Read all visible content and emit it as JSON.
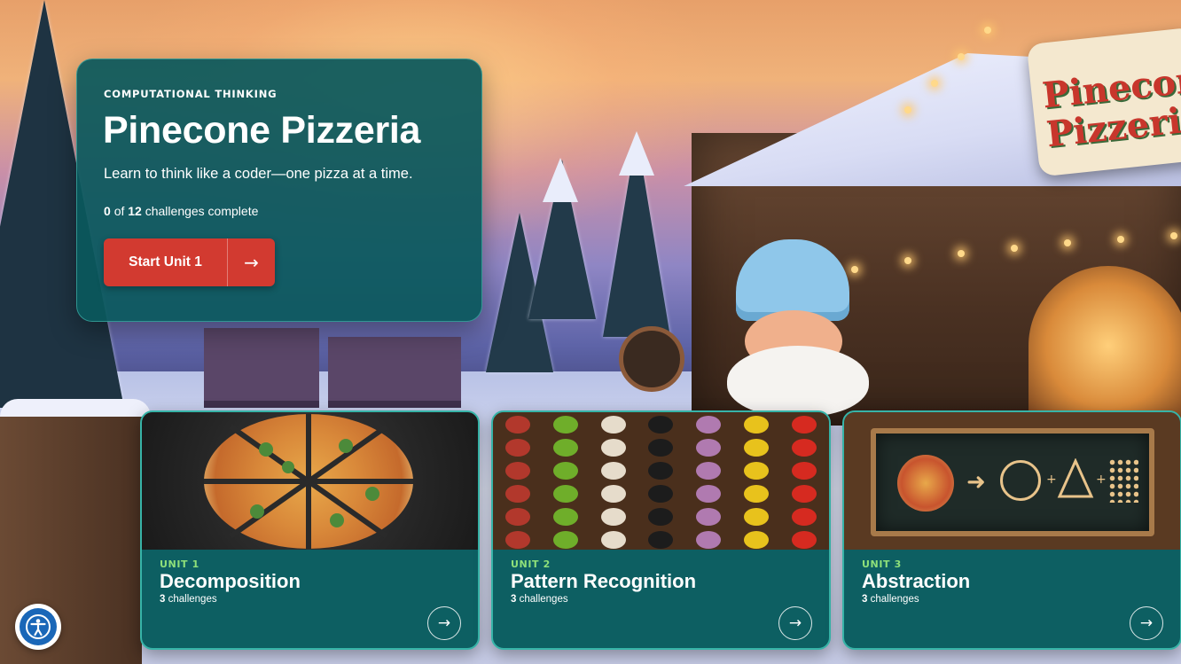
{
  "hero": {
    "eyebrow": "COMPUTATIONAL THINKING",
    "title": "Pinecone Pizzeria",
    "subtitle": "Learn to think like a coder—one pizza at a time.",
    "progress": {
      "completed": "0",
      "of_label": "of",
      "total": "12",
      "suffix": "challenges complete"
    },
    "start_button": {
      "label": "Start Unit 1",
      "arrow": "→"
    }
  },
  "scene": {
    "sign_line1": "Pinecone",
    "sign_line2": "Pizzeria"
  },
  "units": [
    {
      "tag": "UNIT 1",
      "title": "Decomposition",
      "count": "3",
      "count_label": "challenges",
      "arrow": "→",
      "image": "pizza-slices-image"
    },
    {
      "tag": "UNIT 2",
      "title": "Pattern Recognition",
      "count": "3",
      "count_label": "challenges",
      "arrow": "→",
      "image": "ingredient-rows-image"
    },
    {
      "tag": "UNIT 3",
      "title": "Abstraction",
      "count": "3",
      "count_label": "challenges",
      "arrow": "→",
      "image": "chalkboard-shapes-image"
    }
  ],
  "colors": {
    "panel": "#0a585c",
    "accent_red": "#d23a30",
    "unit_tag_green": "#8fe07a",
    "card_border": "#37b4a8"
  },
  "icons": {
    "accessibility": "accessibility-icon",
    "arrow": "arrow-right-icon"
  }
}
